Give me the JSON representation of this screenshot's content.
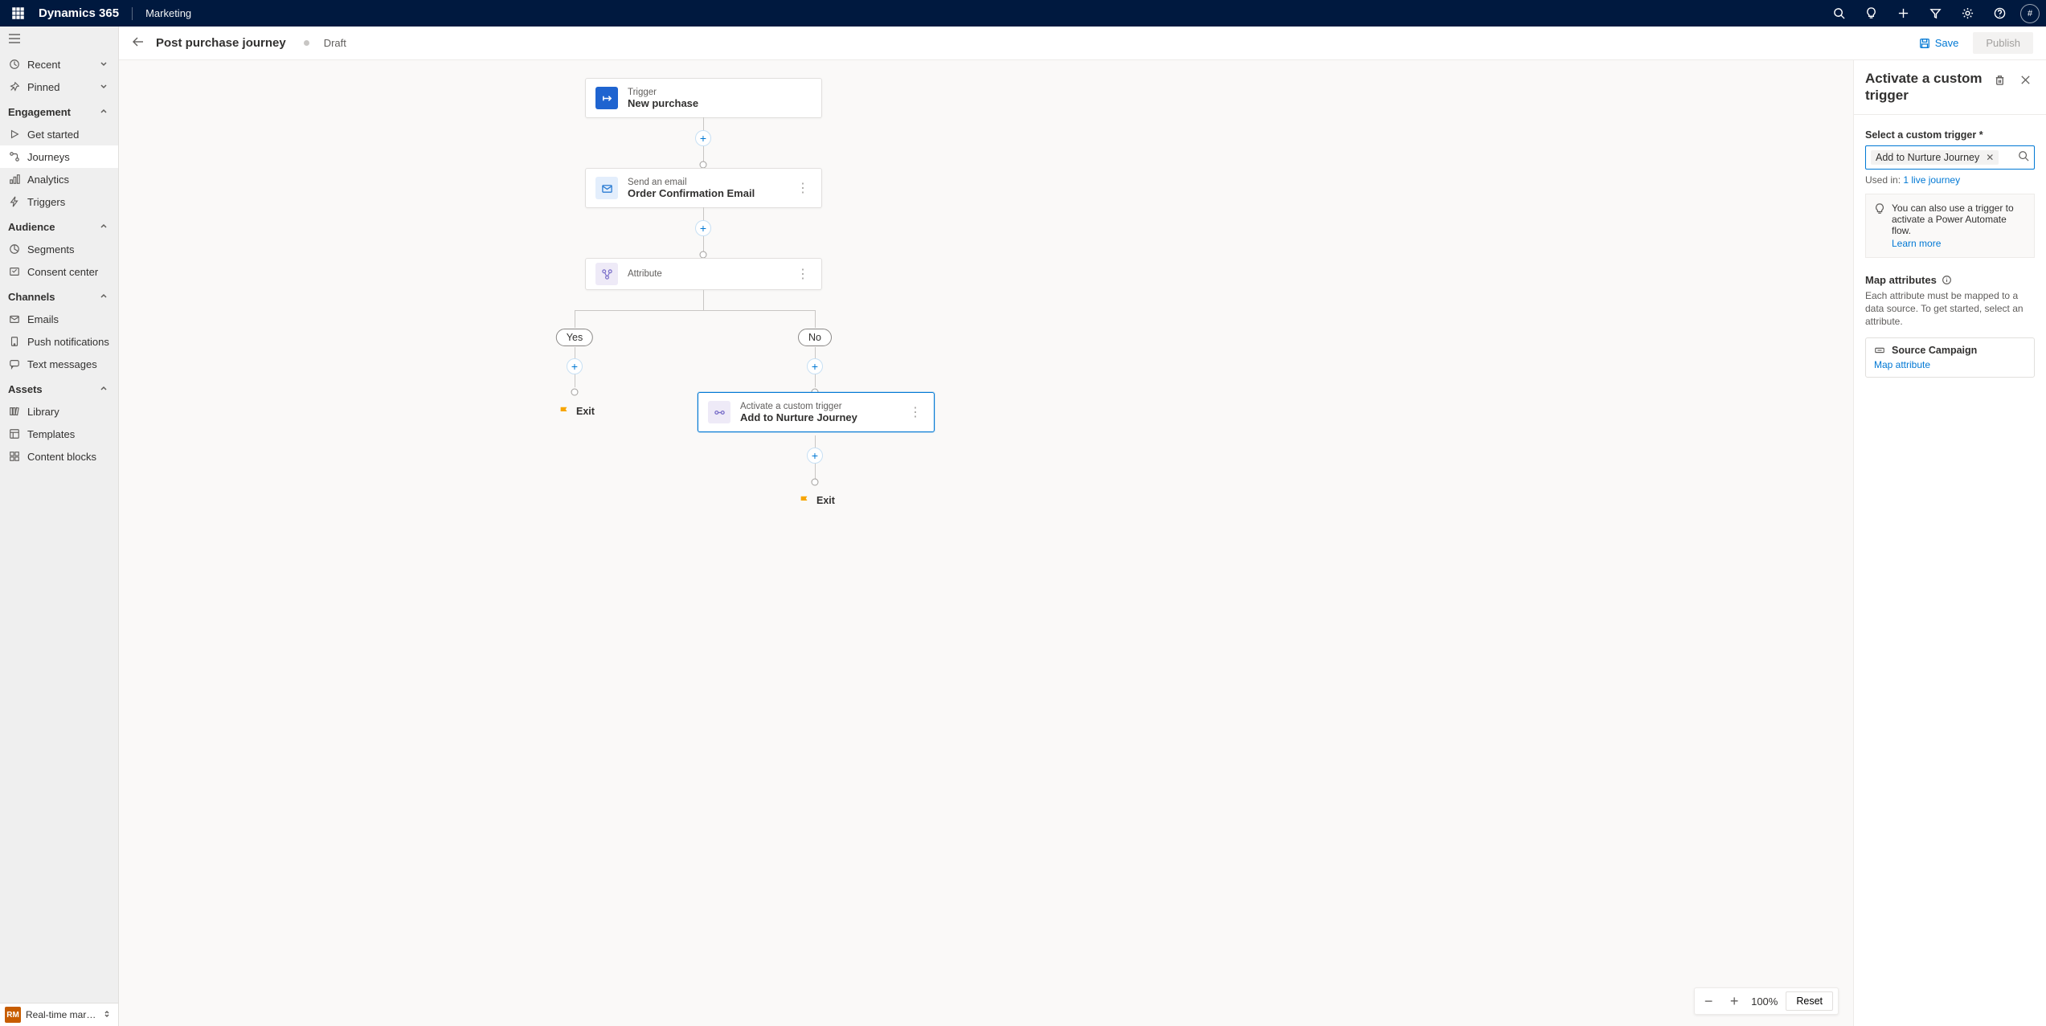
{
  "topbar": {
    "brand": "Dynamics 365",
    "module": "Marketing",
    "avatar_char": "#"
  },
  "sidebar": {
    "recent": "Recent",
    "pinned": "Pinned",
    "groups": {
      "engagement": "Engagement",
      "audience": "Audience",
      "channels": "Channels",
      "assets": "Assets"
    },
    "items": {
      "get_started": "Get started",
      "journeys": "Journeys",
      "analytics": "Analytics",
      "triggers": "Triggers",
      "segments": "Segments",
      "consent_center": "Consent center",
      "emails": "Emails",
      "push": "Push notifications",
      "text": "Text messages",
      "library": "Library",
      "templates": "Templates",
      "content_blocks": "Content blocks"
    },
    "footer_badge": "RM",
    "footer_label": "Real-time marketi..."
  },
  "page": {
    "title": "Post purchase journey",
    "status": "Draft",
    "save": "Save",
    "publish": "Publish"
  },
  "nodes": {
    "trigger": {
      "label": "Trigger",
      "title": "New purchase"
    },
    "email": {
      "label": "Send an email",
      "title": "Order Confirmation Email"
    },
    "attribute": {
      "label": "Attribute",
      "title": ""
    },
    "branch_yes": "Yes",
    "branch_no": "No",
    "custom": {
      "label": "Activate a custom trigger",
      "title": "Add to Nurture Journey"
    },
    "exit": "Exit"
  },
  "zoom": {
    "value": "100%",
    "reset": "Reset"
  },
  "panel": {
    "title": "Activate a custom trigger",
    "select_label": "Select a custom trigger *",
    "chip": "Add to Nurture Journey",
    "used_in_prefix": "Used in: ",
    "used_in_link": "1 live journey",
    "info_text": "You can also use a trigger to activate a Power Automate flow.",
    "info_link": "Learn more",
    "map_header": "Map attributes",
    "map_desc": "Each attribute must be mapped to a data source. To get started, select an attribute.",
    "attr_name": "Source Campaign",
    "attr_link": "Map attribute"
  }
}
